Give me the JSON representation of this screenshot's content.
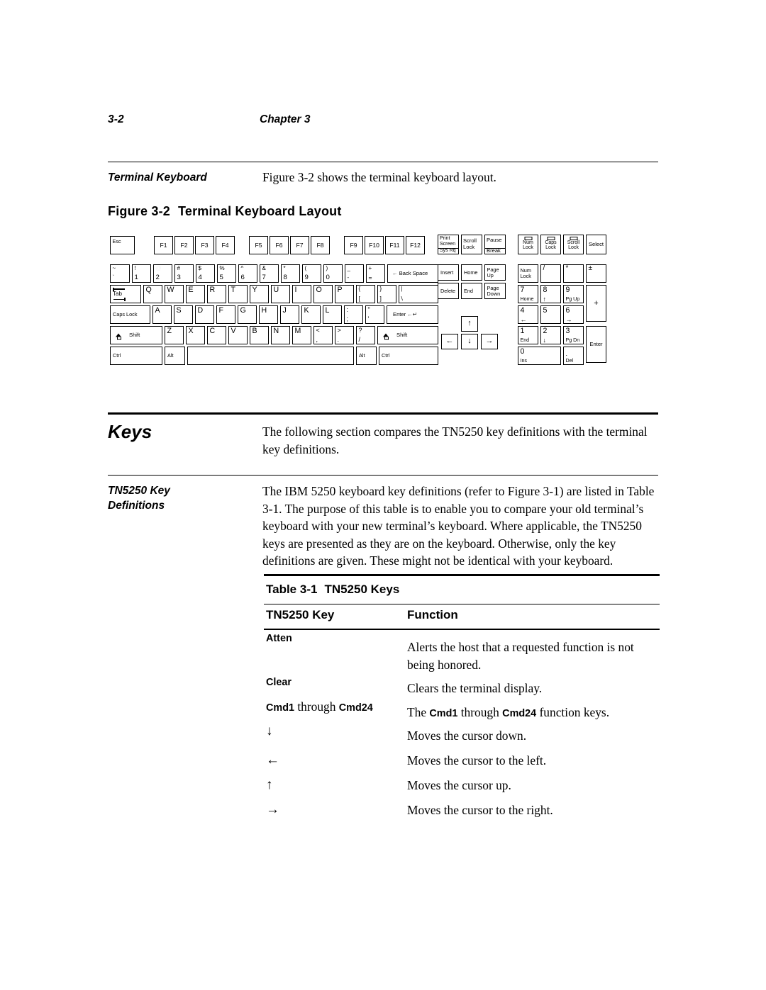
{
  "running_head": {
    "folio": "3-2",
    "chapter": "Chapter  3"
  },
  "sections": {
    "terminal_keyboard": {
      "sidehead": "Terminal Keyboard",
      "body": "Figure 3-2 shows the terminal keyboard layout."
    },
    "keys": {
      "sidehead": "Keys",
      "body": "The following section compares the TN5250 key definitions with the terminal key definitions."
    },
    "tn5250_key_definitions": {
      "sidehead_line1": "TN5250 Key",
      "sidehead_line2": "Definitions",
      "body": "The IBM 5250 keyboard key definitions (refer to Figure 3-1) are listed in Table 3-1. The purpose of this table is to enable you to compare your old terminal’s keyboard with your new terminal’s keyboard. Where applicable, the TN5250 keys are presented as they are on the keyboard. Otherwise, only the key definitions are given. These might not be identical with your keyboard."
    }
  },
  "figure": {
    "number": "Figure 3-2",
    "title": "Terminal Keyboard Layout",
    "keyboard": {
      "function_row": {
        "esc": "Esc",
        "f_keys_group1": [
          "F1",
          "F2",
          "F3",
          "F4"
        ],
        "f_keys_group2": [
          "F5",
          "F6",
          "F7",
          "F8"
        ],
        "f_keys_group3": [
          "F9",
          "F10",
          "F11",
          "F12"
        ]
      },
      "number_row": [
        {
          "shift": "~",
          "base": "`"
        },
        {
          "shift": "!",
          "base": "1"
        },
        {
          "shift": "@",
          "base": "2"
        },
        {
          "shift": "#",
          "base": "3"
        },
        {
          "shift": "$",
          "base": "4"
        },
        {
          "shift": "%",
          "base": "5"
        },
        {
          "shift": "^",
          "base": "6"
        },
        {
          "shift": "&",
          "base": "7"
        },
        {
          "shift": "*",
          "base": "8"
        },
        {
          "shift": "(",
          "base": "9"
        },
        {
          "shift": ")",
          "base": "0"
        },
        {
          "shift": "_",
          "base": "-"
        },
        {
          "shift": "+",
          "base": "="
        }
      ],
      "backspace": "Back Space",
      "tab": "Tab",
      "q_row": [
        "Q",
        "W",
        "E",
        "R",
        "T",
        "Y",
        "U",
        "I",
        "O",
        "P"
      ],
      "q_row_extra": [
        {
          "shift": "{",
          "base": "["
        },
        {
          "shift": "}",
          "base": "]"
        },
        {
          "shift": "|",
          "base": "\\"
        }
      ],
      "caps_lock": "Caps Lock",
      "a_row": [
        "A",
        "S",
        "D",
        "F",
        "G",
        "H",
        "J",
        "K",
        "L"
      ],
      "a_row_extra": [
        {
          "shift": ":",
          "base": ";"
        },
        {
          "shift": "\"",
          "base": "'"
        }
      ],
      "enter": "Enter",
      "shift_left": "Shift",
      "shift_right": "Shift",
      "z_row": [
        "Z",
        "X",
        "C",
        "V",
        "B",
        "N",
        "M"
      ],
      "z_row_extra": [
        {
          "shift": "<",
          "base": ","
        },
        {
          "shift": ">",
          "base": "."
        },
        {
          "shift": "?",
          "base": "/"
        }
      ],
      "ctrl_left": "Ctrl",
      "alt_left": "Alt",
      "space": "",
      "alt_right": "Alt",
      "ctrl_right": "Ctrl",
      "system_row": [
        {
          "line1": "Print",
          "line2": "Screen",
          "line3": "Sys Rq"
        },
        {
          "line1": "Scroll",
          "line2": "Lock"
        },
        {
          "line1": "Pause",
          "line2": "Break"
        }
      ],
      "edit_cluster": [
        [
          "Insert",
          "Home",
          "Page\nUp"
        ],
        [
          "Delete",
          "End",
          "Page\nDown"
        ]
      ],
      "arrows": {
        "up": "↑",
        "left": "←",
        "down": "↓",
        "right": "→"
      },
      "indicators": [
        {
          "label": "Num\nLock",
          "has_led": true
        },
        {
          "label": "Caps\nLock",
          "has_led": true
        },
        {
          "label": "Scroll\nLock",
          "has_led": true
        },
        {
          "label": "Select",
          "has_led": false
        }
      ],
      "numpad": {
        "row1": [
          "Num\nLock",
          "/",
          "*",
          "±"
        ],
        "row2": [
          {
            "num": "7",
            "sub": "Home"
          },
          {
            "num": "8",
            "sub": "↑"
          },
          {
            "num": "9",
            "sub": "Pg Up"
          }
        ],
        "plus": "+",
        "row3": [
          {
            "num": "4",
            "sub": "←"
          },
          {
            "num": "5",
            "sub": ""
          },
          {
            "num": "6",
            "sub": "→"
          }
        ],
        "row4": [
          {
            "num": "1",
            "sub": "End"
          },
          {
            "num": "2",
            "sub": "↓"
          },
          {
            "num": "3",
            "sub": "Pg Dn"
          }
        ],
        "enter": "Enter",
        "row5": [
          {
            "num": "0",
            "sub": "Ins"
          },
          {
            "num": ".",
            "sub": "Del"
          }
        ]
      }
    }
  },
  "table": {
    "number": "Table 3-1",
    "title": "TN5250 Keys",
    "columns": [
      "TN5250 Key",
      "Function"
    ],
    "rows": [
      {
        "key": "Atten",
        "key_style": "bold",
        "function": "Alerts the host that a requested function is not being honored."
      },
      {
        "key": "Clear",
        "key_style": "bold",
        "function": "Clears the terminal display."
      },
      {
        "key": "Cmd1 through Cmd24",
        "key_style": "mixed",
        "function": "The Cmd1 through Cmd24 function keys."
      },
      {
        "key": "↓",
        "key_style": "symbol",
        "function": "Moves the cursor down."
      },
      {
        "key": "←",
        "key_style": "symbol",
        "function": "Moves the cursor to the left."
      },
      {
        "key": "↑",
        "key_style": "symbol",
        "function": "Moves the cursor up."
      },
      {
        "key": "→",
        "key_style": "symbol",
        "function": "Moves the cursor to the right."
      }
    ]
  }
}
